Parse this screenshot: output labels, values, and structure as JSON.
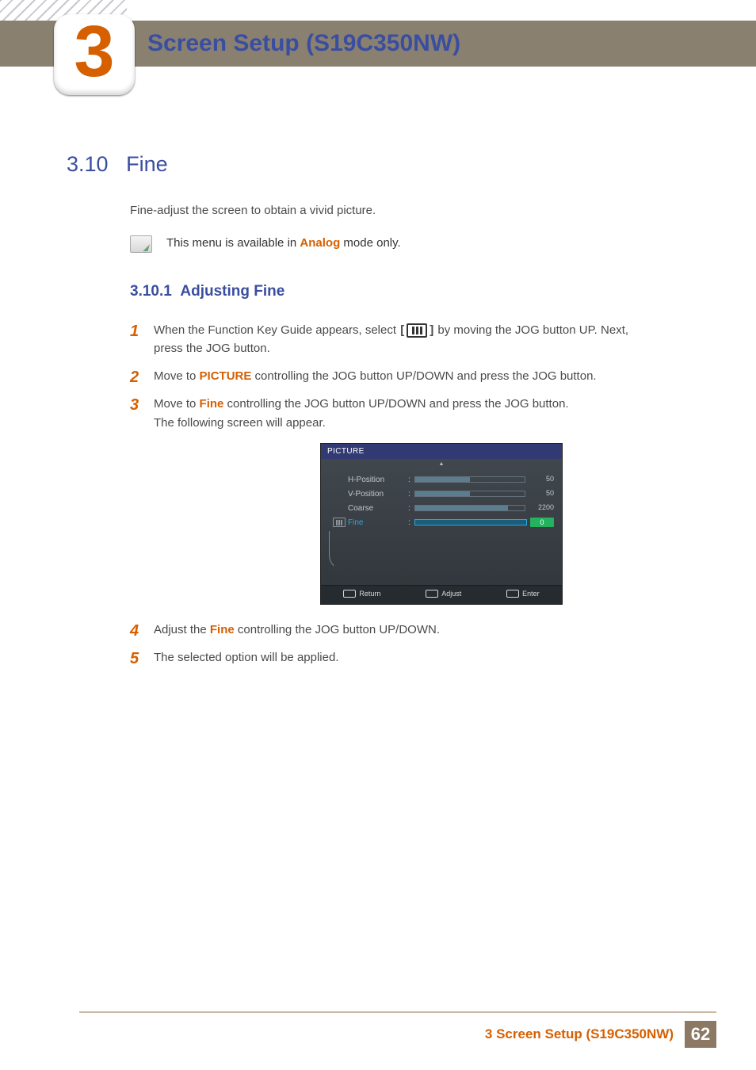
{
  "header": {
    "chapter_num": "3",
    "title": "Screen Setup (S19C350NW)"
  },
  "section": {
    "number": "3.10",
    "title": "Fine",
    "intro": "Fine-adjust the screen to obtain a vivid picture.",
    "note_prefix": "This menu is available in ",
    "note_mode": "Analog",
    "note_suffix": " mode only."
  },
  "subsection": {
    "number": "3.10.1",
    "title": "Adjusting Fine"
  },
  "steps": {
    "s1a": "When the Function Key Guide appears, select ",
    "s1b": " by moving the JOG button UP. Next, press the JOG button.",
    "s2a": "Move to ",
    "s2_hl": "PICTURE",
    "s2b": " controlling the JOG button UP/DOWN and press the JOG button.",
    "s3a": "Move to ",
    "s3_hl": "Fine",
    "s3b": " controlling the JOG button UP/DOWN and press the JOG button.",
    "s3c": "The following screen will appear.",
    "s4a": "Adjust the ",
    "s4_hl": "Fine",
    "s4b": " controlling the JOG button UP/DOWN.",
    "s5": "The selected option will be applied."
  },
  "osd": {
    "title": "PICTURE",
    "rows": [
      {
        "label": "H-Position",
        "value": "50",
        "fill": 50
      },
      {
        "label": "V-Position",
        "value": "50",
        "fill": 50
      },
      {
        "label": "Coarse",
        "value": "2200",
        "fill": 85
      },
      {
        "label": "Fine",
        "value": "0",
        "fill": 0,
        "active": true
      }
    ],
    "footer": {
      "return": "Return",
      "adjust": "Adjust",
      "enter": "Enter"
    }
  },
  "footer": {
    "title": "3 Screen Setup (S19C350NW)",
    "page": "62"
  }
}
